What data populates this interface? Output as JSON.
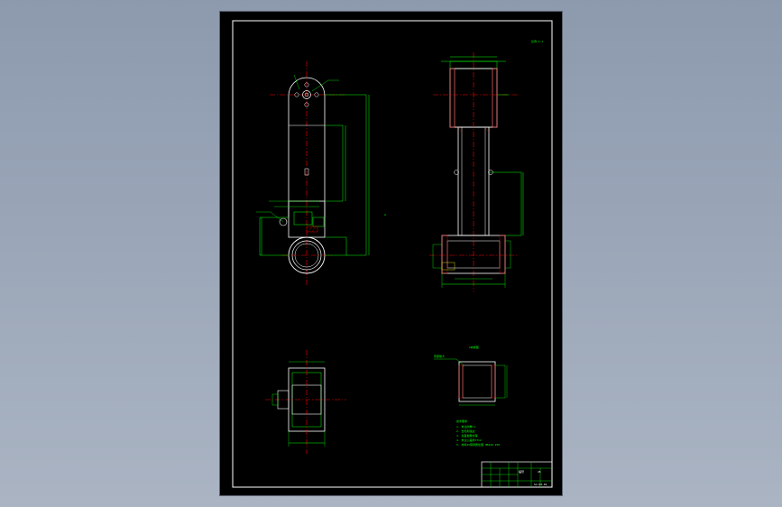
{
  "drawing": {
    "scale_note": "比例 1:1",
    "notes_title": "技术要求",
    "notes": [
      "1. 未注倒角C1",
      "2. 去毛刺锐边",
      "3. 表面发黑处理",
      "4. 未注公差按IT12",
      "5. 材料45钢调质处理 HB220-250"
    ],
    "detail_label": "A向视图",
    "detail_callout": "局部放大",
    "title_block": {
      "part_name": "摆臂",
      "material": "45",
      "drawing_no": "SJ-03-01"
    }
  },
  "colors": {
    "sheet": "#000000",
    "outline": "#ffffff",
    "dimension": "#00ff00",
    "centerline": "#ff0000",
    "annotation": "#ffff00",
    "hatch": "#ff0000"
  }
}
